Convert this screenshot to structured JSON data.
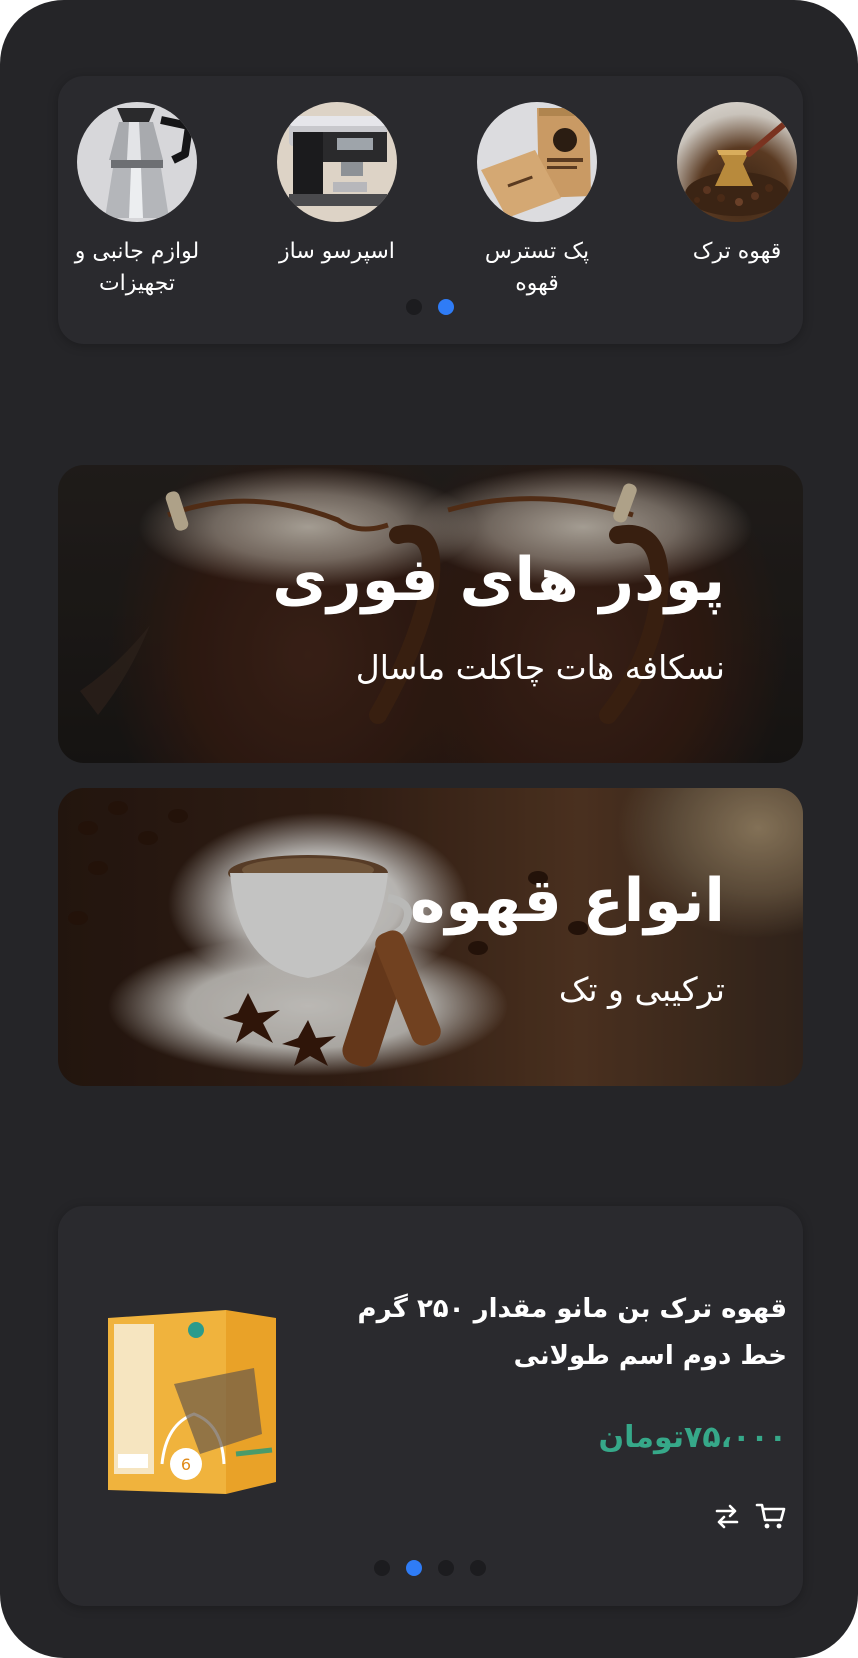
{
  "categories": {
    "items": [
      {
        "label": "قهوه ترک",
        "icon": "turkish-coffee-pot-icon"
      },
      {
        "label": "پک تسترس قهوه",
        "icon": "coffee-bag-icon"
      },
      {
        "label": "اسپرسو ساز",
        "icon": "espresso-machine-icon"
      },
      {
        "label": "لوازم جانبی و تجهیزات",
        "icon": "moka-pot-icon"
      }
    ],
    "dots_total": 2,
    "active_dot": 2
  },
  "banners": [
    {
      "title": "پودر های فوری",
      "subtitle": "نسکافه هات چاکلت ماسال"
    },
    {
      "title": "انواع قهوه",
      "subtitle": "ترکیبی و تک"
    }
  ],
  "product": {
    "title": "قهوه ترک بن مانو مقدار ۲۵۰ گرم خط دوم اسم طولانی",
    "price": "۷۵،۰۰۰",
    "currency": "تومان",
    "price_color": "#36a889",
    "dots_total": 4,
    "active_dot": 2
  },
  "colors": {
    "background": "#252528",
    "card": "#2a2a2e",
    "accent": "#2f7cf6"
  }
}
